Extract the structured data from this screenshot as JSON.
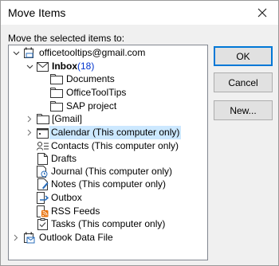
{
  "dialog": {
    "title": "Move Items",
    "prompt": "Move the selected items to:"
  },
  "buttons": {
    "ok": "OK",
    "cancel": "Cancel",
    "new": "New..."
  },
  "tree": {
    "root": "officetooltips@gmail.com",
    "inbox": "Inbox",
    "inbox_count": "(18)",
    "documents": "Documents",
    "officetooltips": "OfficeToolTips",
    "sap": "SAP project",
    "gmail": "[Gmail]",
    "calendar": "Calendar (This computer only)",
    "contacts": "Contacts (This computer only)",
    "drafts": "Drafts",
    "journal": "Journal (This computer only)",
    "notes": "Notes (This computer only)",
    "outbox": "Outbox",
    "rss": "RSS Feeds",
    "tasks": "Tasks (This computer only)",
    "datafile": "Outlook Data File"
  }
}
